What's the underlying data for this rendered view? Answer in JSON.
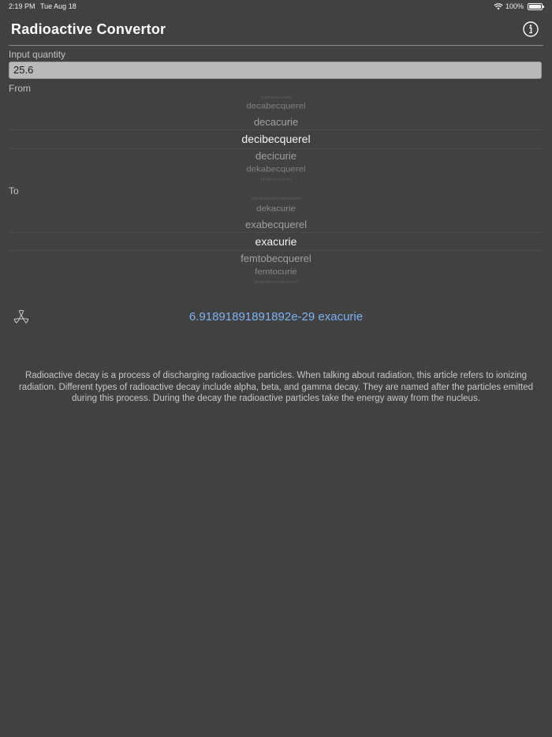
{
  "status_bar": {
    "time": "2:19 PM",
    "date": "Tue Aug 18",
    "battery": "100%"
  },
  "header": {
    "title": "Radioactive Convertor",
    "info_icon": "info-icon"
  },
  "input": {
    "label": "Input quantity",
    "value": "25.6"
  },
  "from_picker": {
    "label": "From",
    "items": [
      "centicurie",
      "decabecquerel",
      "decacurie",
      "decibecquerel",
      "decicurie",
      "dekabecquerel",
      "dekacurie"
    ],
    "selected": "decibecquerel"
  },
  "to_picker": {
    "label": "To",
    "items": [
      "dekabecquerel",
      "dekacurie",
      "exabecquerel",
      "exacurie",
      "femtobecquerel",
      "femtocurie",
      "gigabecquerel"
    ],
    "selected": "exacurie"
  },
  "result": {
    "icon": "radiation-icon",
    "text": "6.91891891891892e-29 exacurie"
  },
  "description": "Radioactive decay is a process of discharging radioactive particles. When talking about radiation, this article refers to ionizing radiation. Different types of radioactive decay include alpha, beta, and gamma decay. They are named after the particles emitted during this process. During the decay the radioactive particles take the energy away from the nucleus.",
  "colors": {
    "background": "#414141",
    "accent": "#7db2f0",
    "input_background": "#b9b9b9"
  }
}
